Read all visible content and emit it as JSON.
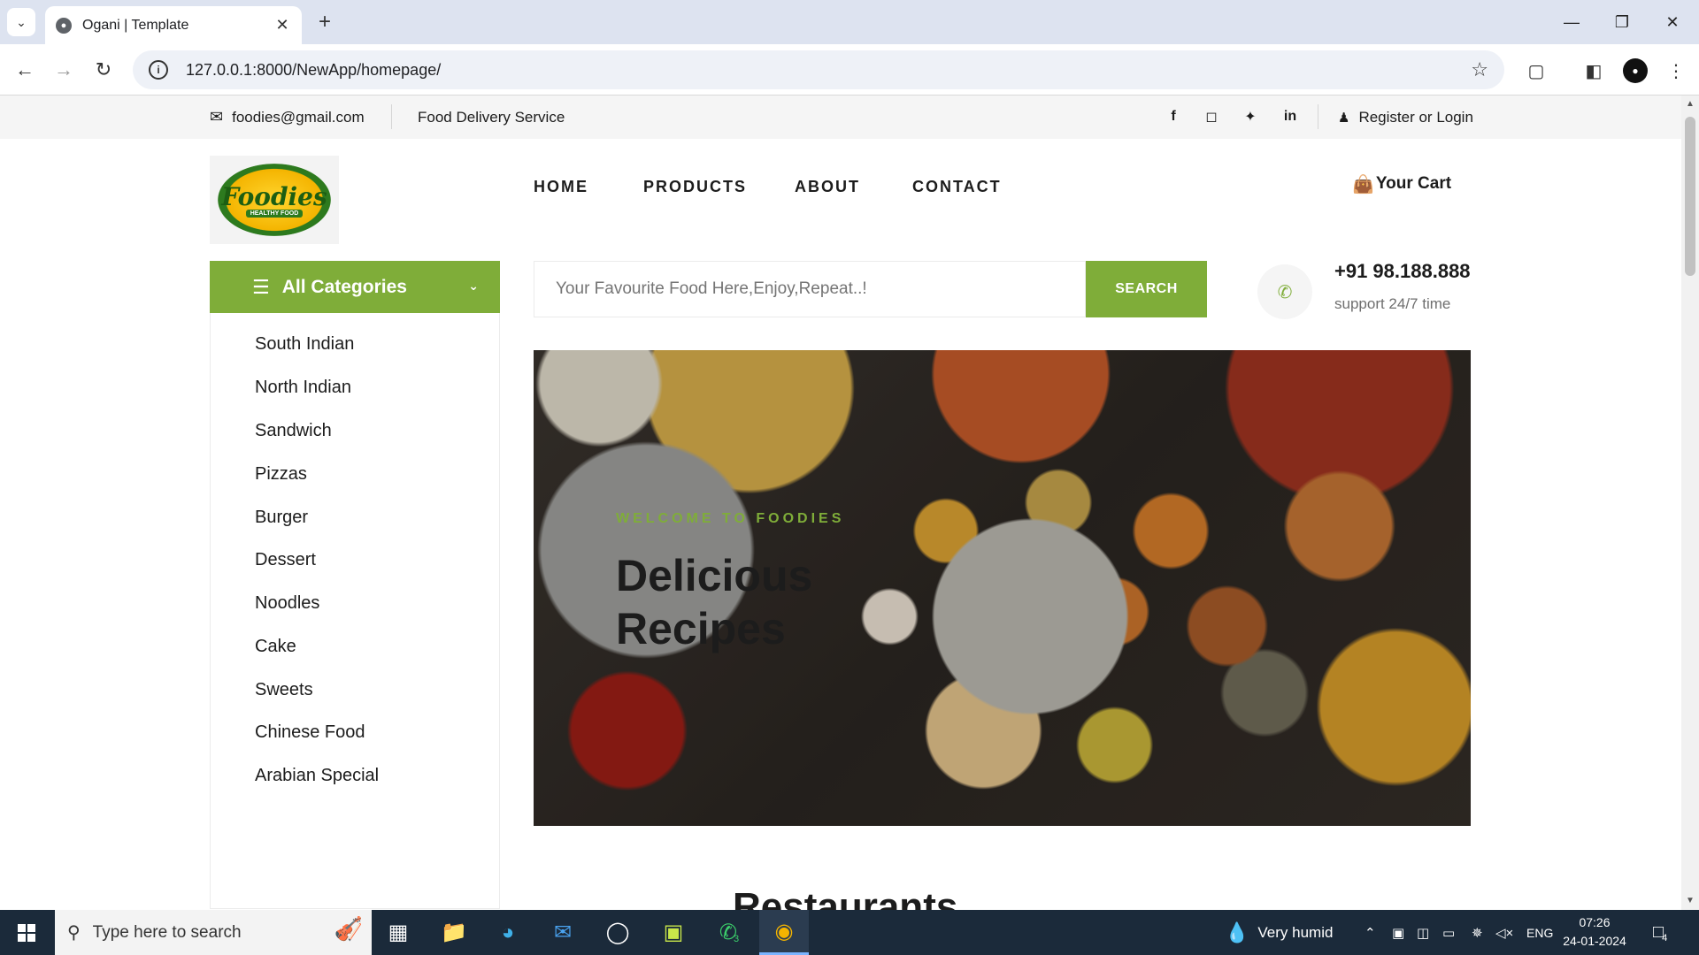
{
  "browser": {
    "tab_title": "Ogani | Template",
    "url": "127.0.0.1:8000/NewApp/homepage/"
  },
  "header_top": {
    "email": "foodies@gmail.com",
    "tagline": "Food Delivery Service",
    "social_icons": [
      "facebook-icon",
      "instagram-icon",
      "twitter-icon",
      "linkedin-icon"
    ],
    "auth_label": "Register or Login"
  },
  "logo": {
    "text": "Foodies",
    "subtext": "HEALTHY FOOD"
  },
  "nav": {
    "items": [
      "HOME",
      "PRODUCTS",
      "ABOUT",
      "CONTACT"
    ],
    "cart_label": "Your Cart"
  },
  "categories": {
    "title": "All Categories",
    "items": [
      "South Indian",
      "North Indian",
      "Sandwich",
      "Pizzas",
      "Burger",
      "Dessert",
      "Noodles",
      "Cake",
      "Sweets",
      "Chinese Food",
      "Arabian Special"
    ]
  },
  "search": {
    "placeholder": "Your Favourite Food Here,Enjoy,Repeat..!",
    "button_label": "SEARCH"
  },
  "support": {
    "phone": "+91 98.188.888",
    "text": "support 24/7 time"
  },
  "hero": {
    "eyebrow": "WELCOME TO FOODIES",
    "title": "Delicious Recipes"
  },
  "section": {
    "title": "Restaurants"
  },
  "taskbar": {
    "search_placeholder": "Type here to search",
    "weather": "Very humid",
    "language": "ENG",
    "time": "07:26",
    "date": "24-01-2024",
    "whatsapp_badge": "3",
    "notification_badge": "4"
  },
  "colors": {
    "accent": "#7fad39",
    "text_dark": "#1c1c1c",
    "taskbar": "#1b2a3a"
  }
}
